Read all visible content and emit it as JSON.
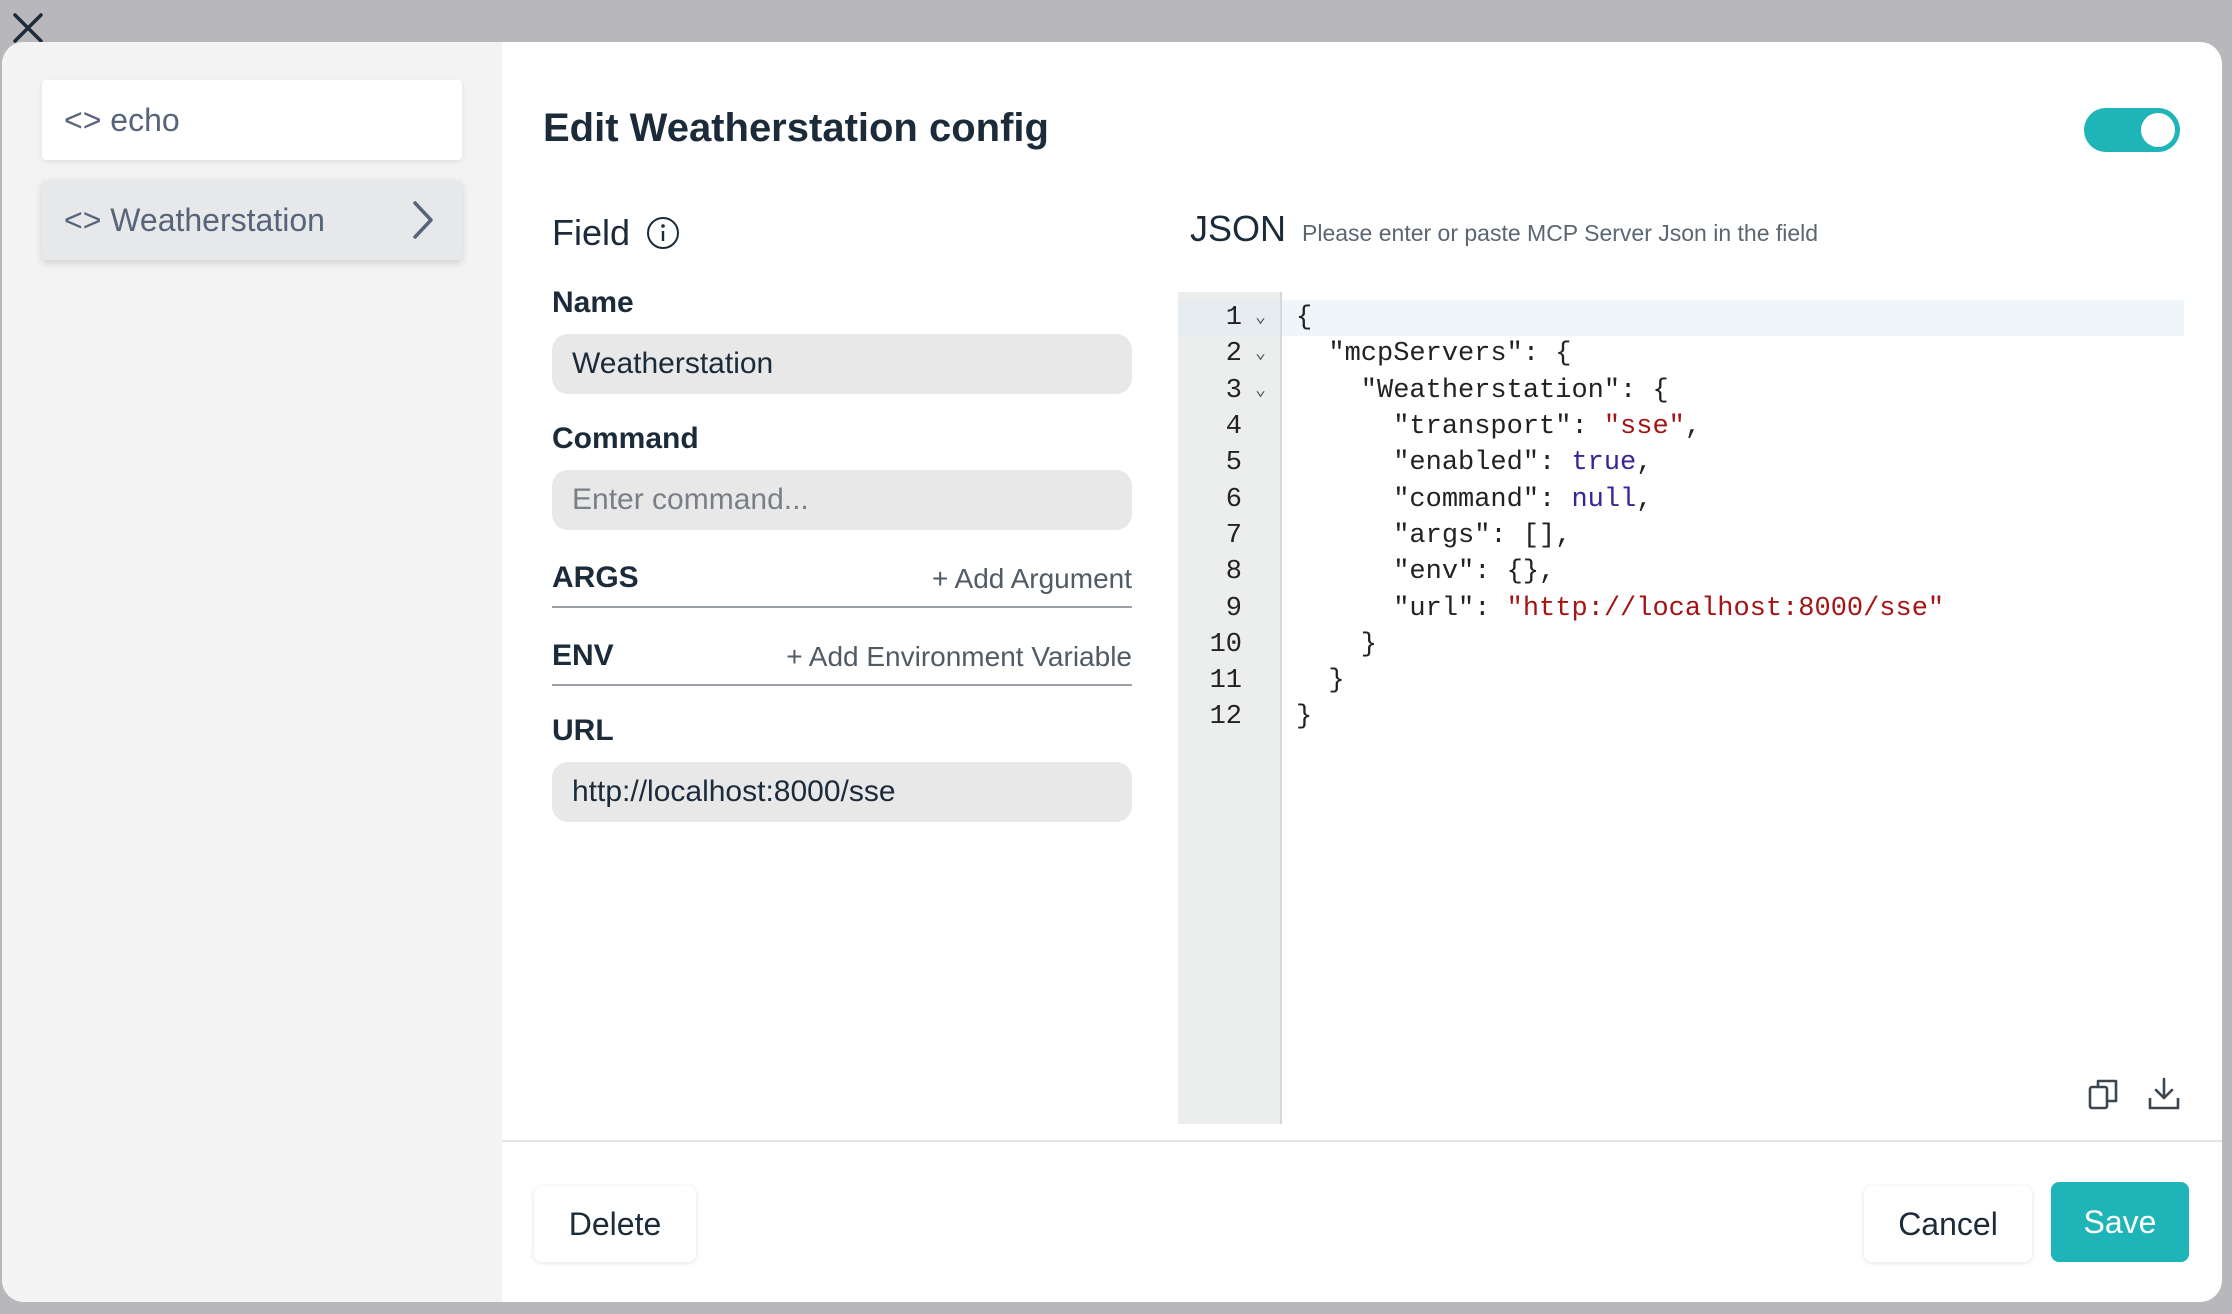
{
  "colors": {
    "accent": "#1fb5b8",
    "string": "#a31515",
    "keyword": "#3a2392"
  },
  "sidebar": {
    "items": [
      {
        "label": "<> echo",
        "active": false
      },
      {
        "label": "<> Weatherstation",
        "active": true
      }
    ]
  },
  "header": {
    "title": "Edit Weatherstation config",
    "enabled": true
  },
  "field": {
    "title": "Field",
    "name_label": "Name",
    "name_value": "Weatherstation",
    "command_label": "Command",
    "command_placeholder": "Enter command...",
    "args_label": "ARGS",
    "add_argument": "+ Add Argument",
    "env_label": "ENV",
    "add_env": "+ Add Environment Variable",
    "url_label": "URL",
    "url_value": "http://localhost:8000/sse"
  },
  "json": {
    "title": "JSON",
    "hint": "Please enter or paste MCP Server Json in the field",
    "line_numbers": [
      "1",
      "2",
      "3",
      "4",
      "5",
      "6",
      "7",
      "8",
      "9",
      "10",
      "11",
      "12"
    ],
    "lines": [
      "{",
      "  \"mcpServers\": {",
      "    \"Weatherstation\": {",
      "      \"transport\": \"sse\",",
      "      \"enabled\": true,",
      "      \"command\": null,",
      "      \"args\": [],",
      "      \"env\": {},",
      "      \"url\": \"http://localhost:8000/sse\"",
      "    }",
      "  }",
      "}"
    ]
  },
  "footer": {
    "delete_label": "Delete",
    "cancel_label": "Cancel",
    "save_label": "Save"
  }
}
